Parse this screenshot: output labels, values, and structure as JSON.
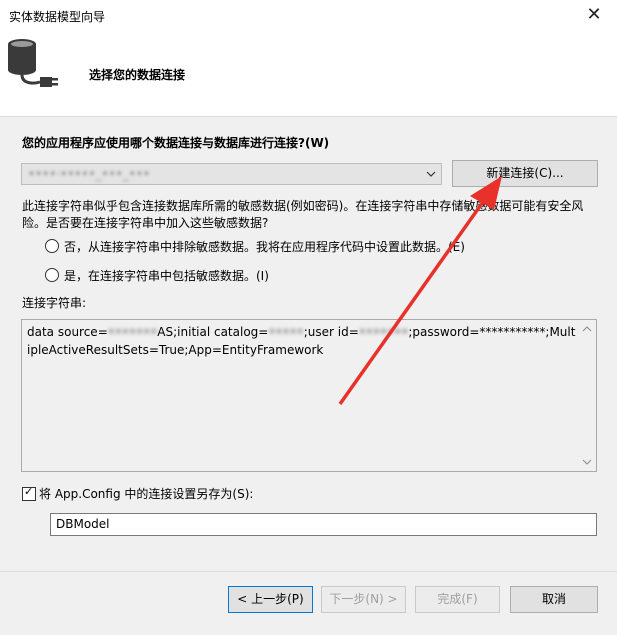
{
  "window": {
    "title": "实体数据模型向导",
    "close_glyph": "✕"
  },
  "header": {
    "title": "选择您的数据连接",
    "icon": "database-plug-icon"
  },
  "question": "您的应用程序应使用哪个数据连接与数据库进行连接?(W)",
  "connection_combo": {
    "value": "••••·•••••_•••_•••"
  },
  "new_connection_button": "新建连接(C)...",
  "sensitive": {
    "warning": "此连接字符串似乎包含连接数据库所需的敏感数据(例如密码)。在连接字符串中存储敏感数据可能有安全风险。是否要在连接字符串中加入这些敏感数据?",
    "options": [
      {
        "label": "否，从连接字符串中排除敏感数据。我将在应用程序代码中设置此数据。(E)",
        "selected": false
      },
      {
        "label": "是，在连接字符串中包括敏感数据。(I)",
        "selected": false
      }
    ]
  },
  "connection_string": {
    "label": "连接字符串:",
    "part1": "data source=",
    "blur1": "•••••••",
    "part2": "AS;initial catalog=",
    "blur2": "•••••",
    "part3": ";user id=",
    "blur3": "•••••••",
    "part4": ";password=***********;MultipleActiveResultSets=True;App=EntityFramework"
  },
  "save_config": {
    "label": "将 App.Config 中的连接设置另存为(S):",
    "checked": true,
    "value": "DBModel"
  },
  "footer": {
    "prev": "< 上一步(P)",
    "next": "下一步(N) >",
    "finish": "完成(F)",
    "cancel": "取消"
  },
  "colors": {
    "annotation_arrow": "#e8312a",
    "primary_border": "#0078d7"
  }
}
